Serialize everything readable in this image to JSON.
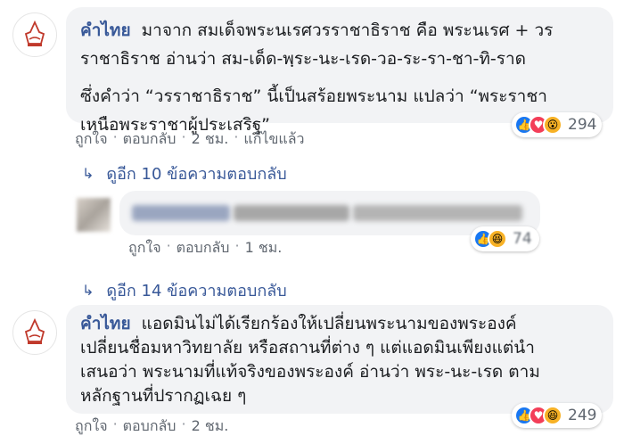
{
  "comment1": {
    "author": "คำไทย",
    "lines": [
      "มาจาก สมเด็จพระนเรศวรราชาธิราช คือ พระนเรศ + วร",
      "ราชาธิราช อ่านว่า สม-เด็ด-พฺระ-นะ-เรด-วอ-ระ-รา-ชา-ทิ-ราด"
    ],
    "paragraph2": [
      "ซึ่งคำว่า “วรราชาธิราช” นี้เป็นสร้อยพระนาม แปลว่า “พระราชา",
      "เหนือพระราชาผู้ประเสริฐ”"
    ],
    "actions": {
      "like": "ถูกใจ",
      "reply": "ตอบกลับ",
      "time": "2 ชม.",
      "edited": "แก้ไขแล้ว"
    },
    "reaction_count": "294",
    "reaction_icons": [
      "like-icon",
      "love-icon",
      "wow-icon"
    ]
  },
  "replies1": {
    "label": "ดูอีก 10 ข้อความตอบกลับ"
  },
  "blurred_reply": {
    "actions": {
      "like": "ถูกใจ",
      "reply": "ตอบกลับ",
      "time": "1 ชม."
    },
    "reaction_count": "74"
  },
  "replies2": {
    "label": "ดูอีก 14 ข้อความตอบกลับ"
  },
  "comment2": {
    "author": "คำไทย",
    "lines": [
      "แอดมินไม่ได้เรียกร้องให้เปลี่ยนพระนามของพระองค์",
      "เปลี่ยนชื่อมหาวิทยาลัย หรือสถานที่ต่าง ๆ แต่แอดมินเพียงแต่นำ",
      "เสนอว่า พระนามที่แท้จริงของพระองค์ อ่านว่า พระ-นะ-เรด ตาม",
      "หลักฐานที่ปรากฏเฉย ๆ"
    ],
    "actions": {
      "like": "ถูกใจ",
      "reply": "ตอบกลับ",
      "time": "2 ชม."
    },
    "reaction_count": "249",
    "reaction_icons": [
      "like-icon",
      "love-icon",
      "haha-icon"
    ]
  }
}
